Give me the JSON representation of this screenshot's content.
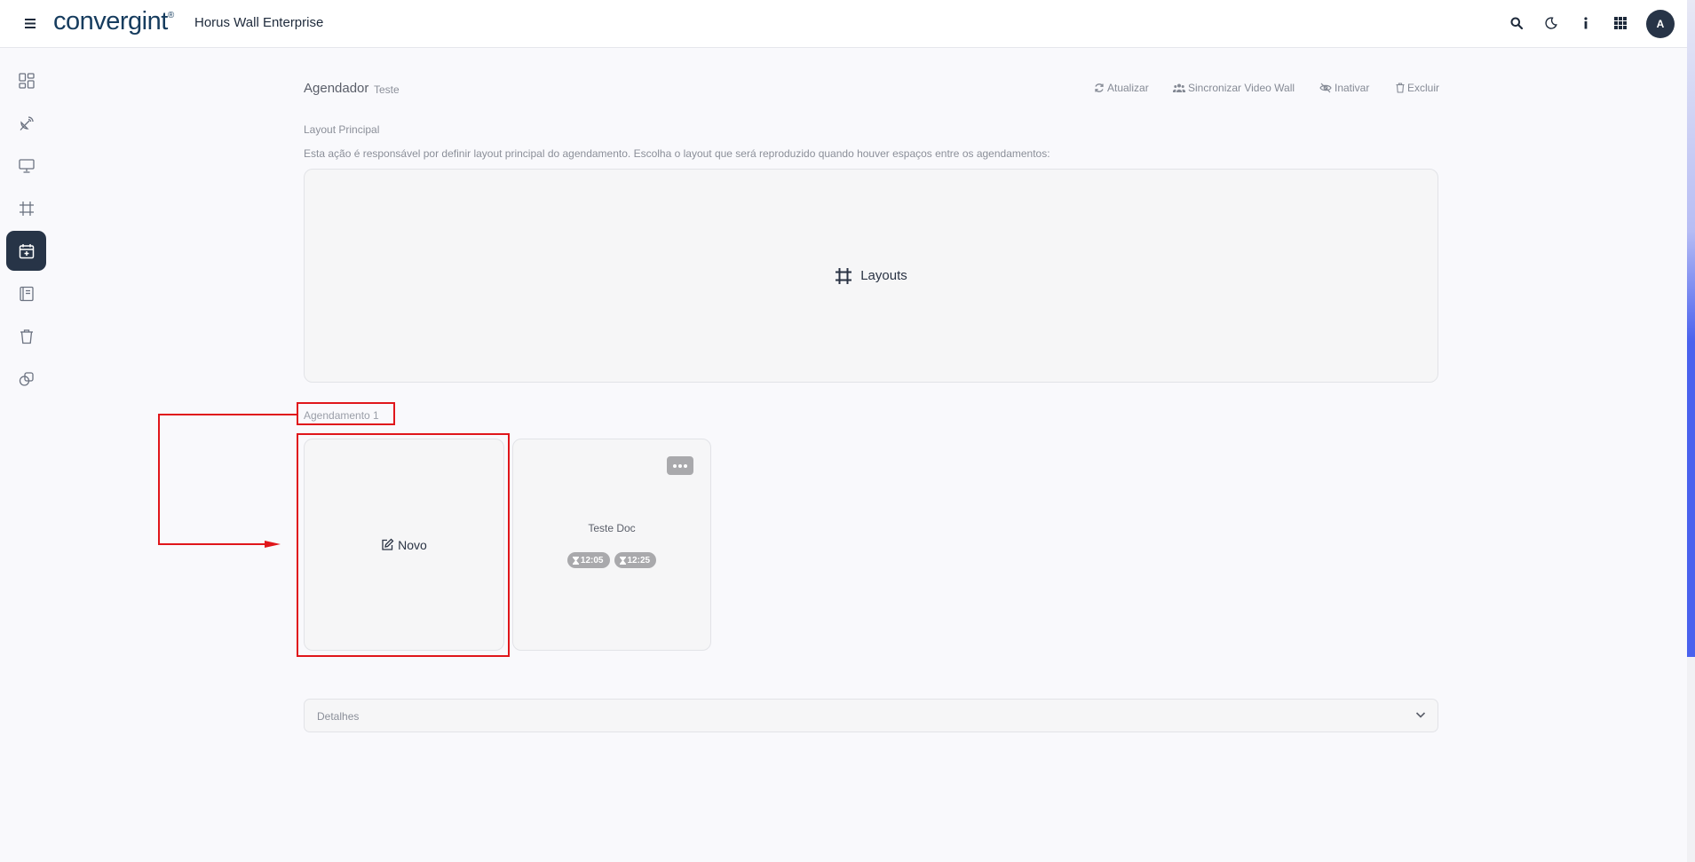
{
  "header": {
    "logo_text": "convergint",
    "logo_mark": "®",
    "app_title": "Horus Wall Enterprise",
    "avatar_initial": "A",
    "icons": [
      "menu-icon",
      "search-icon",
      "moon-icon",
      "info-icon",
      "apps-grid-icon"
    ]
  },
  "sidebar": {
    "items": [
      {
        "icon": "dashboard-icon",
        "active": false
      },
      {
        "icon": "satellite-dish-icon",
        "active": false
      },
      {
        "icon": "monitor-icon",
        "active": false
      },
      {
        "icon": "frame-icon",
        "active": false
      },
      {
        "icon": "calendar-plus-icon",
        "active": true
      },
      {
        "icon": "journal-icon",
        "active": false
      },
      {
        "icon": "trash-icon",
        "active": false
      },
      {
        "icon": "copy-icon",
        "active": false
      }
    ]
  },
  "page": {
    "title": "Agendador",
    "subtitle": "Teste",
    "actions": [
      {
        "label": "Atualizar",
        "icon": "refresh-icon"
      },
      {
        "label": "Sincronizar Video Wall",
        "icon": "users-icon"
      },
      {
        "label": "Inativar",
        "icon": "eye-slash-icon"
      },
      {
        "label": "Excluir",
        "icon": "trash-icon"
      }
    ]
  },
  "layout_section": {
    "label": "Layout Principal",
    "description": "Esta ação é responsável por definir layout principal do agendamento. Escolha o layout que será reproduzido quando houver espaços entre os agendamentos:",
    "button_label": "Layouts"
  },
  "schedule_section": {
    "label": "Agendamento 1",
    "new_card_label": "Novo",
    "cards": [
      {
        "title": "Teste Doc",
        "start": "12:05",
        "end": "12:25"
      }
    ]
  },
  "details": {
    "label": "Detalhes"
  },
  "colors": {
    "accent_dark": "#273447",
    "annotation_red": "#e0161b",
    "badge_gray": "#a9a9ac"
  }
}
